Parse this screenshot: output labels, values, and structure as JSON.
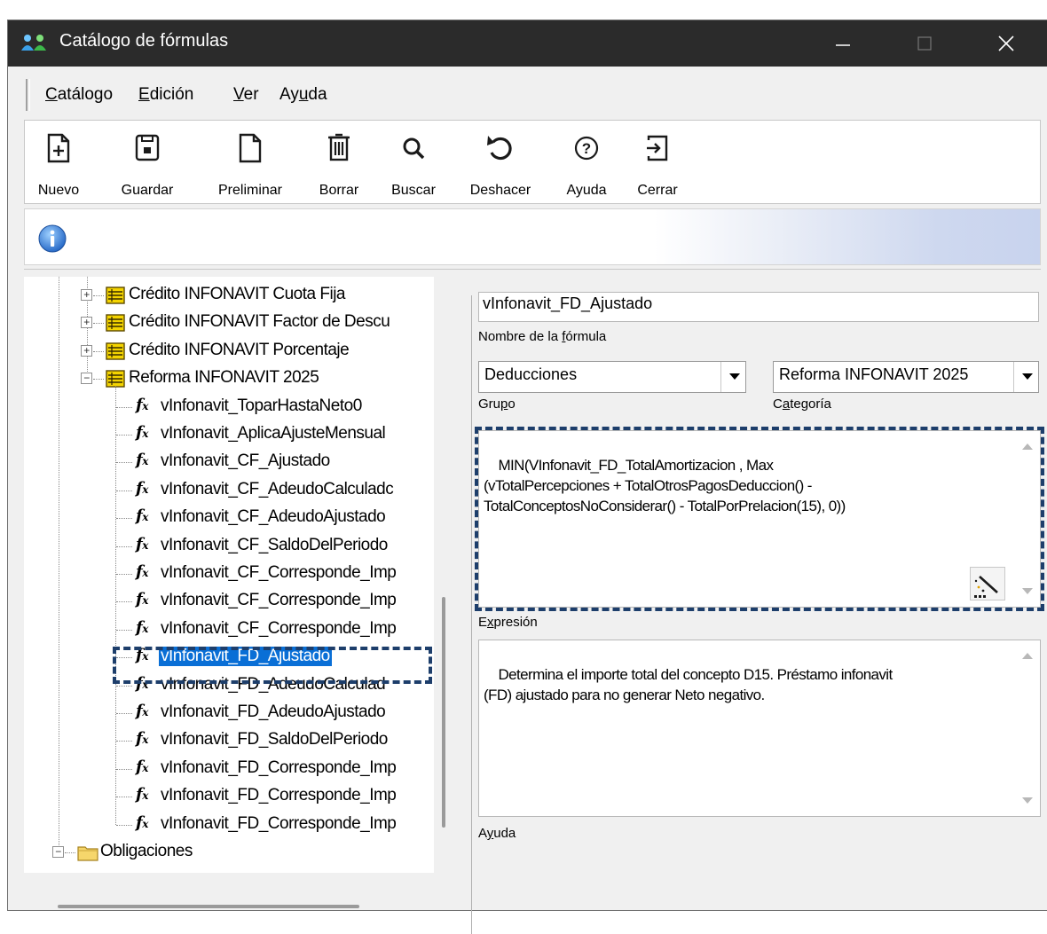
{
  "window": {
    "title": "Catálogo de fórmulas"
  },
  "menu": [
    {
      "label": "Catálogo",
      "key": "C",
      "rest": "atálogo"
    },
    {
      "label": "Edición",
      "key": "E",
      "rest": "dición"
    },
    {
      "label": "Ver",
      "key": "V",
      "rest": "er"
    },
    {
      "label": "Ayuda",
      "pre": "Ay",
      "key": "u",
      "rest": "da"
    }
  ],
  "toolbar": {
    "nuevo": "Nuevo",
    "guardar": "Guardar",
    "preliminar": "Preliminar",
    "borrar": "Borrar",
    "buscar": "Buscar",
    "deshacer": "Deshacer",
    "ayuda": "Ayuda",
    "cerrar": "Cerrar"
  },
  "tree": {
    "folders": [
      "Crédito INFONAVIT Cuota Fija",
      "Crédito INFONAVIT Factor de Descu",
      "Crédito INFONAVIT Porcentaje",
      "Reforma INFONAVIT 2025"
    ],
    "formulas": [
      "vInfonavit_ToparHastaNeto0",
      "vInfonavit_AplicaAjusteMensual",
      "vInfonavit_CF_Ajustado",
      "vInfonavit_CF_AdeudoCalculadc",
      "vInfonavit_CF_AdeudoAjustado",
      "vInfonavit_CF_SaldoDelPeriodo",
      "vInfonavit_CF_Corresponde_Imp",
      "vInfonavit_CF_Corresponde_Imp",
      "vInfonavit_CF_Corresponde_Imp",
      "vInfonavit_FD_Ajustado",
      "vInfonavit_FD_AdeudoCalculad",
      "vInfonavit_FD_AdeudoAjustado",
      "vInfonavit_FD_SaldoDelPeriodo",
      "vInfonavit_FD_Corresponde_Imp",
      "vInfonavit_FD_Corresponde_Imp",
      "vInfonavit_FD_Corresponde_Imp"
    ],
    "selected_index": 9,
    "bottom_folder": "Obligaciones"
  },
  "form": {
    "nombre_value": "vInfonavit_FD_Ajustado",
    "nombre_caption_pre": "Nombre de la ",
    "nombre_caption_key": "f",
    "nombre_caption_rest": "órmula",
    "grupo_value": "Deducciones",
    "grupo_caption_pre": "Gru",
    "grupo_caption_key": "p",
    "grupo_caption_rest": "o",
    "categoria_value": "Reforma INFONAVIT 2025",
    "categoria_caption_pre": "C",
    "categoria_caption_key": "a",
    "categoria_caption_rest": "tegoría",
    "expresion_value": "MIN(VInfonavit_FD_TotalAmortizacion , Max\n(vTotalPercepciones + TotalOtrosPagosDeduccion() -\nTotalConceptosNoConsiderar() - TotalPorPrelacion(15), 0))",
    "expresion_caption_pre": "E",
    "expresion_caption_key": "x",
    "expresion_caption_rest": "presión",
    "ayuda_value": "Determina el importe total del concepto D15. Préstamo infonavit\n(FD) ajustado para no generar Neto negativo.",
    "ayuda_caption_pre": "A",
    "ayuda_caption_key": "y",
    "ayuda_caption_rest": "uda"
  },
  "colors": {
    "titlebar": "#2b2b2b",
    "selection": "#0a6fd6",
    "highlight_dash": "#1d3e6b",
    "tree_icon_yellow": "#f4d400"
  }
}
